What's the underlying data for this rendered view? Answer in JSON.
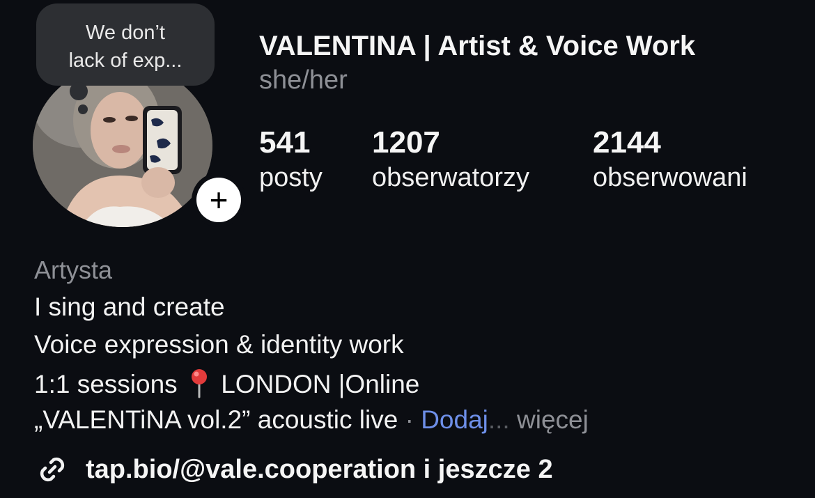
{
  "note": {
    "line1": "We don’t",
    "line2": "lack of exp..."
  },
  "profile": {
    "username": "VALENTINA | Artist & Voice Work",
    "pronouns": "she/her"
  },
  "stats": {
    "posts": {
      "value": "541",
      "label": "posty"
    },
    "followers": {
      "value": "1207",
      "label": "obserwatorzy"
    },
    "following": {
      "value": "2144",
      "label": "obserwowani"
    }
  },
  "bio": {
    "category": "Artysta",
    "line1": "I sing and create",
    "line2": "Voice expression & identity work",
    "line3_before": "1:1 sessions",
    "line3_after": "LONDON |Online",
    "line4": "„VALENTiNA vol.2” acoustic live",
    "separator": "·",
    "translate": "Dodaj",
    "ellipsis": "...",
    "more": "więcej"
  },
  "link": {
    "text": "tap.bio/@vale.cooperation i jeszcze 2"
  },
  "icons": {
    "avatar": "profile-photo",
    "add_story": "plus-icon",
    "location": "round-pushpin-icon",
    "link": "chain-link-icon"
  },
  "colors": {
    "background": "#0b0d12",
    "secondary_text": "#8e9096",
    "link_accent": "#6e8fe8",
    "note_bubble": "#2d2f33"
  }
}
